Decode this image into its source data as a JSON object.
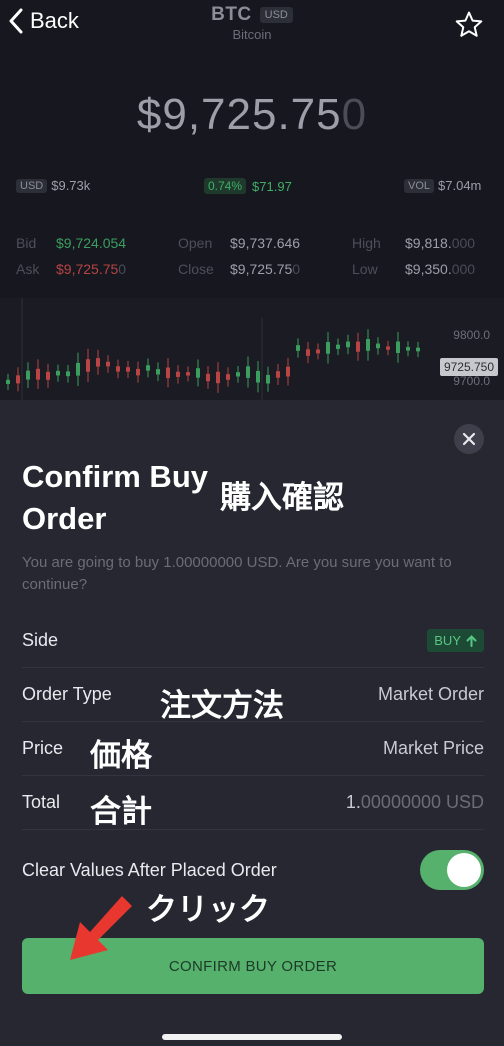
{
  "header": {
    "back_label": "Back",
    "symbol": "BTC",
    "currency_badge": "USD",
    "asset_name": "Bitcoin"
  },
  "price": {
    "main": "$9,725.75",
    "tail": "0"
  },
  "stats": {
    "currency": "USD",
    "currency_value": "$9.73k",
    "change_pct": "0.74%",
    "change_value": "$71.97",
    "vol_label": "VOL",
    "vol_value": "$7.04m"
  },
  "ohlc": {
    "bid_label": "Bid",
    "bid_main": "$9,724.054",
    "bid_tail": "",
    "ask_label": "Ask",
    "ask_main": "$9,725.75",
    "ask_tail": "0",
    "open_label": "Open",
    "open_value": "$9,737.646",
    "close_label": "Close",
    "close_main": "$9,725.75",
    "close_tail": "0",
    "high_label": "High",
    "high_main": "$9,818.",
    "high_tail": "000",
    "low_label": "Low",
    "low_main": "$9,350.",
    "low_tail": "000"
  },
  "chart": {
    "axis_top": "9800.0",
    "axis_bottom": "9700.0",
    "current_price": "9725.750"
  },
  "modal": {
    "title": "Confirm Buy Order",
    "annotation_title": "購入確認",
    "subtitle": "You are going to buy 1.00000000 USD. Are you sure you want to continue?",
    "rows": [
      {
        "label": "Side",
        "value": "BUY"
      },
      {
        "label": "Order Type",
        "value": "Market Order",
        "annotation": "注文方法"
      },
      {
        "label": "Price",
        "value": "Market Price",
        "annotation": "価格"
      },
      {
        "label": "Total",
        "value_main": "1.",
        "value_tail": "00000000 USD",
        "annotation": "合計"
      }
    ],
    "toggle_label": "Clear Values After Placed Order",
    "toggle_on": true,
    "click_annotation": "クリック",
    "confirm_label": "CONFIRM BUY ORDER"
  },
  "colors": {
    "accent_green": "#56b16d",
    "arrow_red": "#e8372f",
    "bid_green": "#3b9d5e",
    "ask_red": "#b84444"
  }
}
